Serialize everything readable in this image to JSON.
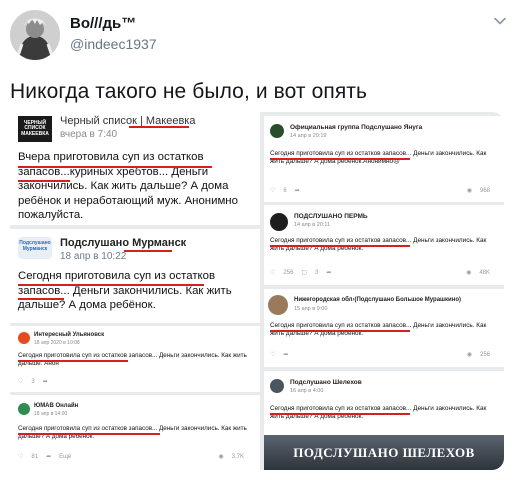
{
  "tweet": {
    "display_name": "Во///дь™",
    "handle": "@indeec1937",
    "text": "Никогда такого не было, и вот опять"
  },
  "icons": {
    "chevron": "chevron-down-icon",
    "share": "share-icon",
    "like": "heart-icon",
    "views": "eye-icon"
  },
  "colors": {
    "underline": "#d61f1f",
    "twitter_gray": "#657786"
  },
  "media": {
    "card1": {
      "group": "Черный список | Макеевка",
      "avatar_text": "ЧЕРНЫЙ СПИСОК МАКЕЕВКА",
      "date": "вчера в 7:40",
      "text": "Вчера приготовила суп из остатков запасов...куриных хребтов... Деньги закончились. Как жить дальше? А дома ребёнок и неработающий муж. Анонимно пожалуйста."
    },
    "card2": {
      "group": "Подслушано Мурманск",
      "avatar_text": "Подслушано Мурманск",
      "date": "18 апр в 10:22",
      "text": "Сегодня приготовила суп из остатков запасов... Деньги закончились. Как жить дальше? А дома ребёнок."
    },
    "card3": {
      "group": "Интересный Ульяновск",
      "date": "18 апр 2020 в 10:08",
      "text": "Сегодня приготовила суп из остатков запасов... Деньги закончились. Как жить дальше. Анон",
      "likes": "3"
    },
    "card4": {
      "group": "ЮМАВ Онлайн",
      "date": "18 апр в 14:00",
      "text": "Сегодня приготовила суп из остатков запасов... Деньги закончились. Как жить дальше? А дома ребёнок.",
      "likes": "81",
      "share": "Ещё",
      "views": "3.7K"
    },
    "card5": {
      "group": "Официальная группа Подслушано Януга",
      "date": "14 апр в 20:19",
      "text": "Сегодня приготовила суп из остатков запасов... Деньги закончились. Как жить дальше? А дома ребёнок.Анонимно😞",
      "likes": "6",
      "views": "968"
    },
    "card6": {
      "group": "ПОДСЛУШАНО ПЕРМЬ",
      "date": "14 апр в 20:11",
      "text": "Сегодня приготовила суп из остатков запасов... Деньги закончились. Как жить дальше? А дома ребёнок.",
      "likes": "256",
      "comments": "3",
      "views": "48K"
    },
    "card7": {
      "group": "Нижегородская обл›(Подслушано Большое Мурашкино)",
      "date": "15 апр в 9:00",
      "text": "Сегодня приготовила суп из остатков запасов... Деньги закончились. Как жить дальше? А дома ребёнок.",
      "views": "256"
    },
    "card8": {
      "group": "Подслушано Шелехов",
      "date": "16 апр в 4:00",
      "text": "Сегодня приготовила суп из остатков запасов... Деньги закончились. Как жить дальше? А дома ребёнок.",
      "banner": "ПОДСЛУШАНО ШЕЛЕХОВ"
    }
  }
}
